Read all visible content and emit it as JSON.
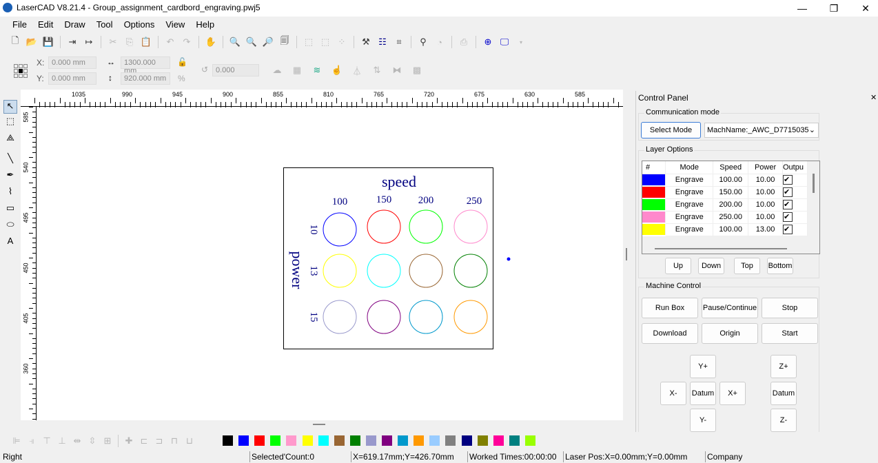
{
  "title": "LaserCAD V8.21.4 - Group_assignment_cardbord_engraving.pwj5",
  "window": {
    "minimize": "—",
    "maximize": "❐",
    "close": "✕"
  },
  "menu": [
    "File",
    "Edit",
    "Draw",
    "Tool",
    "Options",
    "View",
    "Help"
  ],
  "toolbar": {
    "icons": [
      "new-file-icon",
      "open-folder-icon",
      "save-icon",
      "import-icon",
      "export-icon",
      "cut-icon",
      "copy-icon",
      "paste-icon",
      "undo-icon",
      "redo-icon",
      "pan-hand-icon",
      "zoom-in-icon",
      "zoom-out-icon",
      "zoom-selection-icon",
      "zoom-page-icon",
      "group-icon",
      "ungroup-icon",
      "delete-nodes-icon",
      "hammer-icon",
      "array-icon",
      "node-edit-icon",
      "path-icon",
      "cut-order-icon",
      "output-icon",
      "laser-target-icon",
      "monitor-icon"
    ]
  },
  "props": {
    "x_label": "X:",
    "x_value": "0.000 mm",
    "y_label": "Y:",
    "y_value": "0.000 mm",
    "width_value": "1300.000 mm",
    "height_value": "920.000 mm",
    "rotation_value": "0.000",
    "percent": "%"
  },
  "ruler": {
    "top": [
      "1035",
      "990",
      "945",
      "900",
      "855",
      "810",
      "765",
      "720",
      "675",
      "630",
      "585"
    ],
    "left": [
      "585",
      "540",
      "495",
      "450",
      "405",
      "360"
    ]
  },
  "design": {
    "title": "speed",
    "speed_labels": [
      "100",
      "150",
      "200",
      "250"
    ],
    "power_title": "power",
    "power_labels": [
      "10",
      "13",
      "15"
    ],
    "circle_colors": [
      [
        "#0000ff",
        "#ff0000",
        "#00ff00",
        "#ff88cc"
      ],
      [
        "#ffff00",
        "#00ffff",
        "#996633",
        "#008000"
      ],
      [
        "#9999cc",
        "#800080",
        "#0099cc",
        "#ff9900"
      ]
    ]
  },
  "panel": {
    "title": "Control Panel",
    "close": "✕",
    "comm": {
      "title": "Communication mode",
      "select_mode": "Select Mode",
      "machine": "MachName:_AWC_D7715035"
    },
    "layers": {
      "title": "Layer Options",
      "headers": [
        "#",
        "Mode",
        "Speed",
        "Power",
        "Outpu"
      ],
      "rows": [
        {
          "color": "#0000ff",
          "mode": "Engrave",
          "speed": "100.00",
          "power": "10.00",
          "output": true
        },
        {
          "color": "#ff0000",
          "mode": "Engrave",
          "speed": "150.00",
          "power": "10.00",
          "output": true
        },
        {
          "color": "#00ff00",
          "mode": "Engrave",
          "speed": "200.00",
          "power": "10.00",
          "output": true
        },
        {
          "color": "#ff88cc",
          "mode": "Engrave",
          "speed": "250.00",
          "power": "10.00",
          "output": true
        },
        {
          "color": "#ffff00",
          "mode": "Engrave",
          "speed": "100.00",
          "power": "13.00",
          "output": true
        }
      ],
      "buttons": [
        "Up",
        "Down",
        "Top",
        "Bottom"
      ]
    },
    "machine": {
      "title": "Machine Control",
      "buttons": [
        "Run Box",
        "Pause/Continue",
        "Stop",
        "Download",
        "Origin",
        "Start"
      ],
      "jog": {
        "yplus": "Y+",
        "xminus": "X-",
        "datum": "Datum",
        "xplus": "X+",
        "yminus": "Y-",
        "zplus": "Z+",
        "zdatum": "Datum",
        "zminus": "Z-"
      }
    }
  },
  "palette": [
    "#000000",
    "#0000ff",
    "#ff0000",
    "#00ff00",
    "#ff99cc",
    "#ffff00",
    "#00ffff",
    "#996633",
    "#008000",
    "#9999cc",
    "#800080",
    "#0099cc",
    "#ff9900",
    "#99ccff",
    "#808080",
    "#000080",
    "#808000",
    "#ff0099",
    "#008080",
    "#99ff00"
  ],
  "status": {
    "mode": "Right",
    "selected": "Selected'Count:0",
    "cursor": "X=619.17mm;Y=426.70mm",
    "worked": "Worked Times:00:00:00",
    "laser": "Laser Pos:X=0.00mm;Y=0.00mm",
    "company": "Company"
  }
}
